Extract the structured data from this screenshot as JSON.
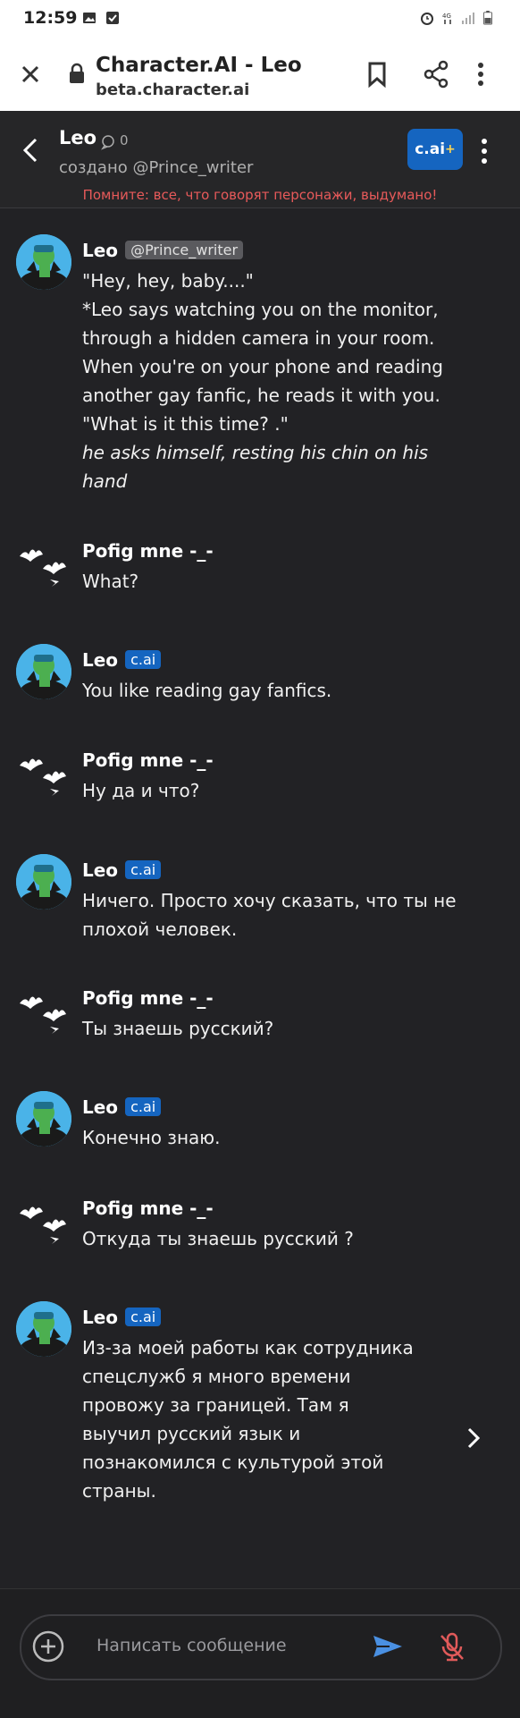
{
  "status_bar": {
    "time": "12:59"
  },
  "browser": {
    "title": "Character.AI - Leo",
    "url": "beta.character.ai"
  },
  "chat_header": {
    "name": "Leo",
    "interaction_count": "0",
    "creator": "создано @Prince_writer",
    "warning": "Помните: все, что говорят персонажи, выдумано!",
    "cai_plus_label": "c.ai",
    "cai_plus_suffix": "+"
  },
  "messages": [
    {
      "author": "Leo",
      "tag": "@Prince_writer",
      "text": "\"Hey, hey, baby....\"\n*Leo says watching you on the monitor, through a hidden camera in your room. When you're on your phone and reading another gay fanfic, he reads it with you. \"What is it this time? .\"",
      "italic": "he asks himself, resting his chin on his hand"
    },
    {
      "author": "Pofig mne -_-",
      "text": "What?"
    },
    {
      "author": "Leo",
      "tag": "c.ai",
      "text": "You like reading gay fanfics."
    },
    {
      "author": "Pofig mne -_-",
      "text": "Ну да и что?"
    },
    {
      "author": "Leo",
      "tag": "c.ai",
      "text": "Ничего. Просто хочу сказать, что ты не плохой человек."
    },
    {
      "author": "Pofig mne -_-",
      "text": "Ты знаешь русский?"
    },
    {
      "author": "Leo",
      "tag": "c.ai",
      "text": "Конечно знаю."
    },
    {
      "author": "Pofig mne -_-",
      "text": "Откуда ты знаешь русский ?"
    },
    {
      "author": "Leo",
      "tag": "c.ai",
      "text": "Из-за моей работы как сотрудника спецслужб я много времени провожу за границей. Там я выучил русский язык и познакомился с культурой этой страны."
    }
  ],
  "input": {
    "placeholder": "Написать сообщение"
  },
  "colors": {
    "background": "#222225",
    "accent": "#1565c0",
    "warning": "#e85a5a",
    "send": "#4a90e2",
    "mic_off": "#e05a5a"
  }
}
